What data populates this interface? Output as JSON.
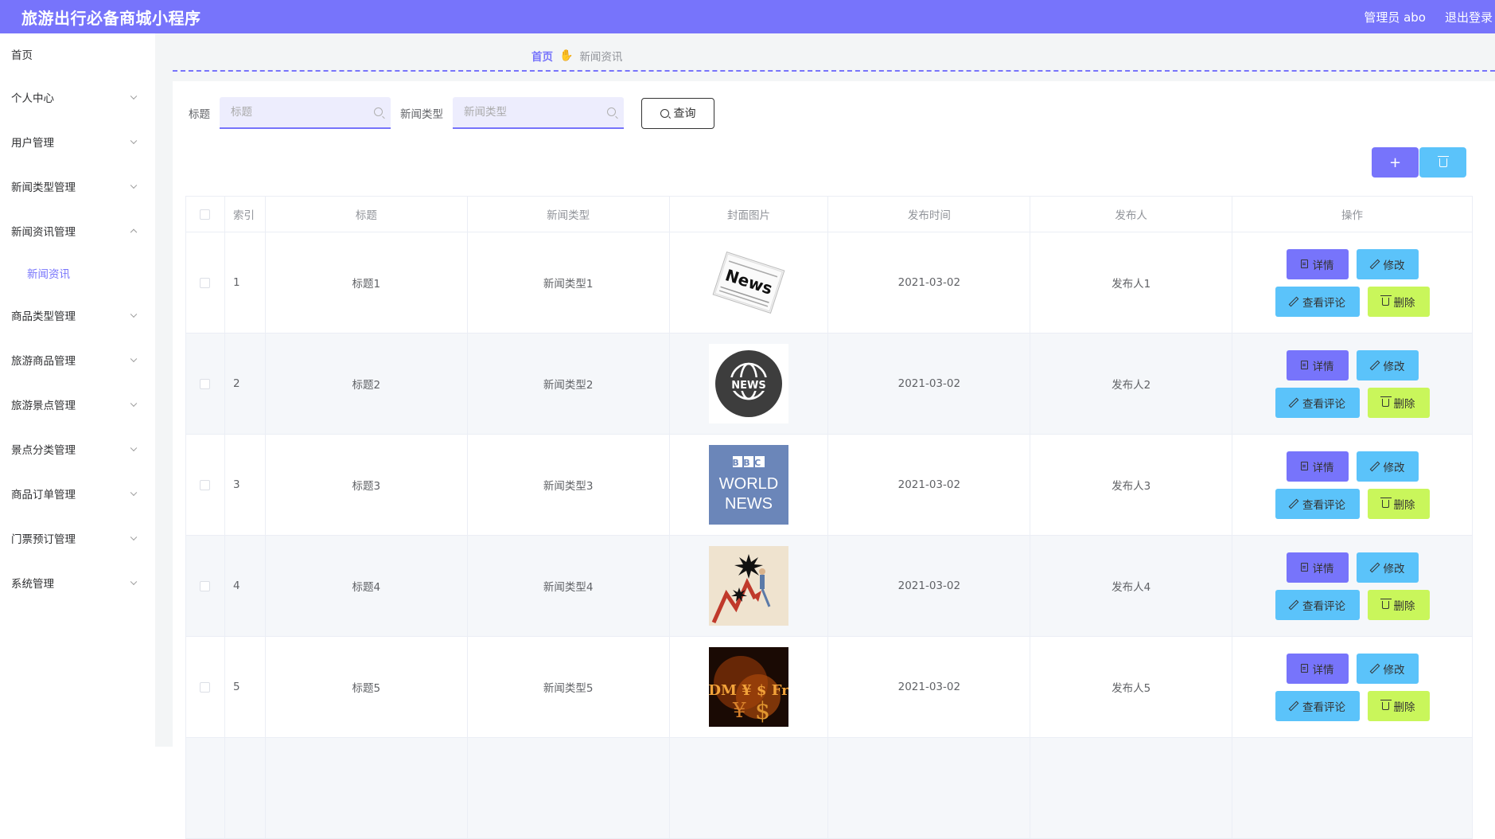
{
  "header": {
    "app_title": "旅游出行必备商城小程序",
    "admin_label": "管理员 abo",
    "logout_label": "退出登录"
  },
  "sidebar": {
    "items": [
      {
        "label": "首页"
      },
      {
        "label": "个人中心"
      },
      {
        "label": "用户管理"
      },
      {
        "label": "新闻类型管理"
      },
      {
        "label": "新闻资讯管理",
        "children": [
          {
            "label": "新闻资讯"
          }
        ]
      },
      {
        "label": "商品类型管理"
      },
      {
        "label": "旅游商品管理"
      },
      {
        "label": "旅游景点管理"
      },
      {
        "label": "景点分类管理"
      },
      {
        "label": "商品订单管理"
      },
      {
        "label": "门票预订管理"
      },
      {
        "label": "系统管理"
      }
    ]
  },
  "breadcrumb": {
    "home": "首页",
    "current": "新闻资讯"
  },
  "search": {
    "title_label": "标题",
    "title_placeholder": "标题",
    "type_label": "新闻类型",
    "type_placeholder": "新闻类型",
    "query_label": "查询"
  },
  "actions": {
    "add_symbol": "+"
  },
  "table": {
    "headers": [
      "索引",
      "标题",
      "新闻类型",
      "封面图片",
      "发布时间",
      "发布人",
      "操作"
    ],
    "rows": [
      {
        "index": "1",
        "title": "标题1",
        "type": "新闻类型1",
        "cover": "news-paper",
        "date": "2021-03-02",
        "publisher": "发布人1"
      },
      {
        "index": "2",
        "title": "标题2",
        "type": "新闻类型2",
        "cover": "news-globe",
        "date": "2021-03-02",
        "publisher": "发布人2"
      },
      {
        "index": "3",
        "title": "标题3",
        "type": "新闻类型3",
        "cover": "bbc-world-news",
        "date": "2021-03-02",
        "publisher": "发布人3"
      },
      {
        "index": "4",
        "title": "标题4",
        "type": "新闻类型4",
        "cover": "market-chart",
        "date": "2021-03-02",
        "publisher": "发布人4"
      },
      {
        "index": "5",
        "title": "标题5",
        "type": "新闻类型5",
        "cover": "currency-symbols",
        "date": "2021-03-02",
        "publisher": "发布人5"
      }
    ],
    "op_labels": {
      "detail": "详情",
      "edit": "修改",
      "comments": "查看评论",
      "delete": "删除"
    }
  },
  "cover_text": {
    "paper": "News",
    "globe": "NEWS",
    "bbc_top": "BBC",
    "bbc_mid": "WORLD",
    "bbc_bot": "NEWS",
    "currency": "DM ¥ $ Fr"
  },
  "colors": {
    "primary": "#7774fb",
    "info": "#5bc3fa",
    "success": "#c9f65b"
  }
}
